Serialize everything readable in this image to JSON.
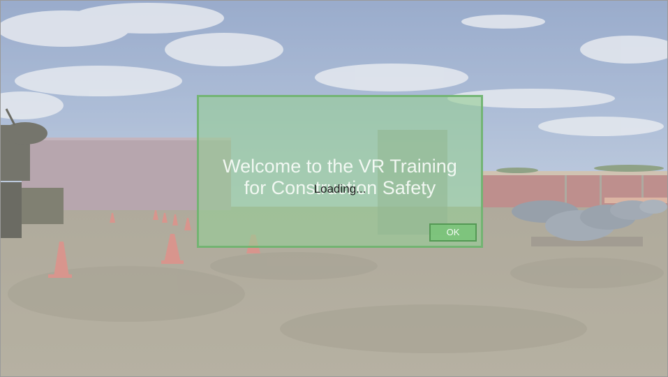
{
  "dialog": {
    "welcome_text": "Welcome to the VR Training\nfor Construction Safety",
    "loading_text": "Loading...",
    "ok_label": "OK"
  },
  "colors": {
    "dialog_fill": "#96cd96",
    "dialog_border": "#6eb26e",
    "ok_button": "#78c478"
  }
}
